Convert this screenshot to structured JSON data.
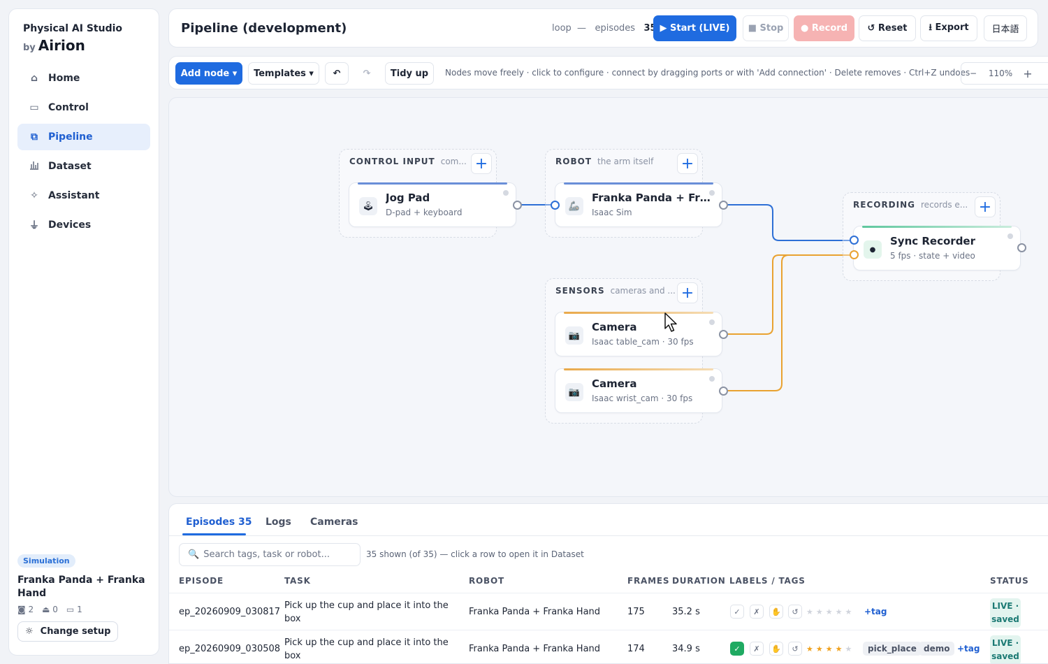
{
  "sidebar": {
    "brand_title": "Physical AI Studio",
    "brand_by": "by",
    "brand_name": "Airion",
    "nav": [
      {
        "label": "Home",
        "icon": "home-icon",
        "glyph": "⌂"
      },
      {
        "label": "Control",
        "icon": "gamepad-icon",
        "glyph": "▭"
      },
      {
        "label": "Pipeline",
        "icon": "pipeline-icon",
        "glyph": "⧉",
        "active": true
      },
      {
        "label": "Dataset",
        "icon": "chart-icon",
        "glyph": "📊"
      },
      {
        "label": "Assistant",
        "icon": "sparkle-icon",
        "glyph": "✧"
      },
      {
        "label": "Devices",
        "icon": "plug-icon",
        "glyph": "⏚"
      }
    ],
    "mode_badge": "Simulation",
    "robot_name": "Franka Panda + Franka Hand",
    "cameras_count": "2",
    "robots_count": "0",
    "controllers_count": "1",
    "change_setup": "Change setup"
  },
  "header": {
    "title": "Pipeline (development)",
    "loop_label": "loop",
    "loop_sep": "—",
    "episodes_label": "episodes",
    "episodes_count": "35",
    "start": "▶ Start (LIVE)",
    "stop": "■ Stop",
    "record": "● Record",
    "reset": "↺ Reset",
    "export": "⭳ Export",
    "lang": "日本語"
  },
  "toolbar": {
    "add_node": "Add node ▾",
    "templates": "Templates ▾",
    "undo": "↶",
    "redo": "↷",
    "tidy": "Tidy up",
    "hint": "Nodes move freely · click to configure · connect by dragging ports or with 'Add connection' · Delete removes · Ctrl+Z undoes",
    "zoom_out": "−",
    "zoom_level": "110%",
    "zoom_in": "+"
  },
  "canvas": {
    "groups": [
      {
        "title": "CONTROL INPUT",
        "subtitle": "com..."
      },
      {
        "title": "ROBOT",
        "subtitle": "the arm itself"
      },
      {
        "title": "SENSORS",
        "subtitle": "cameras and ..."
      },
      {
        "title": "RECORDING",
        "subtitle": "records e..."
      }
    ],
    "nodes": [
      {
        "title": "Jog Pad",
        "subtitle": "D-pad + keyboard",
        "icon": "joystick-icon",
        "glyph": "🕹",
        "color": "#6a8fd8"
      },
      {
        "title": "Franka Panda + Fran...",
        "subtitle": "Isaac Sim",
        "icon": "robot-arm-icon",
        "glyph": "🦾",
        "color": "#6a8fd8"
      },
      {
        "title": "Camera",
        "subtitle": "Isaac table_cam · 30 fps",
        "icon": "camera-icon",
        "glyph": "📷",
        "color": "#e9a94a"
      },
      {
        "title": "Camera",
        "subtitle": "Isaac wrist_cam · 30 fps",
        "icon": "camera-icon",
        "glyph": "📷",
        "color": "#e9a94a"
      },
      {
        "title": "Sync Recorder",
        "subtitle": "5 fps · state + video",
        "icon": "record-dot-icon",
        "glyph": "●",
        "color": "#5fc79e"
      }
    ],
    "wire_colors": {
      "state": "#2d6fd6",
      "video": "#e9a230"
    }
  },
  "panel": {
    "tabs": [
      "Episodes 35",
      "Logs",
      "Cameras"
    ],
    "search_placeholder": "Search tags, task or robot...",
    "search_meta": "35 shown (of 35) — click a row to open it in Dataset",
    "columns": [
      "EPISODE",
      "TASK",
      "ROBOT",
      "FRAMES",
      "DURATION",
      "LABELS / TAGS",
      "STATUS"
    ],
    "rows": [
      {
        "episode": "ep_20260909_030817",
        "task_l1": "Pick up the cup and place it into the",
        "task_l2": "box",
        "robot": "Franka Panda + Franka Hand",
        "frames": "175",
        "duration": "35.2 s",
        "success": false,
        "rating": 0,
        "tags": [],
        "add_tag": "+tag",
        "status_l1": "LIVE ·",
        "status_l2": "saved"
      },
      {
        "episode": "ep_20260909_030508",
        "task_l1": "Pick up the cup and place it into the",
        "task_l2": "box",
        "robot": "Franka Panda + Franka Hand",
        "frames": "174",
        "duration": "34.9 s",
        "success": true,
        "rating": 4,
        "tags": [
          "pick_place",
          "demo"
        ],
        "add_tag": "+tag",
        "status_l1": "LIVE ·",
        "status_l2": "saved"
      }
    ],
    "label_glyphs": {
      "check": "✓",
      "cross": "✗",
      "hand": "✋",
      "redo": "↺"
    }
  }
}
